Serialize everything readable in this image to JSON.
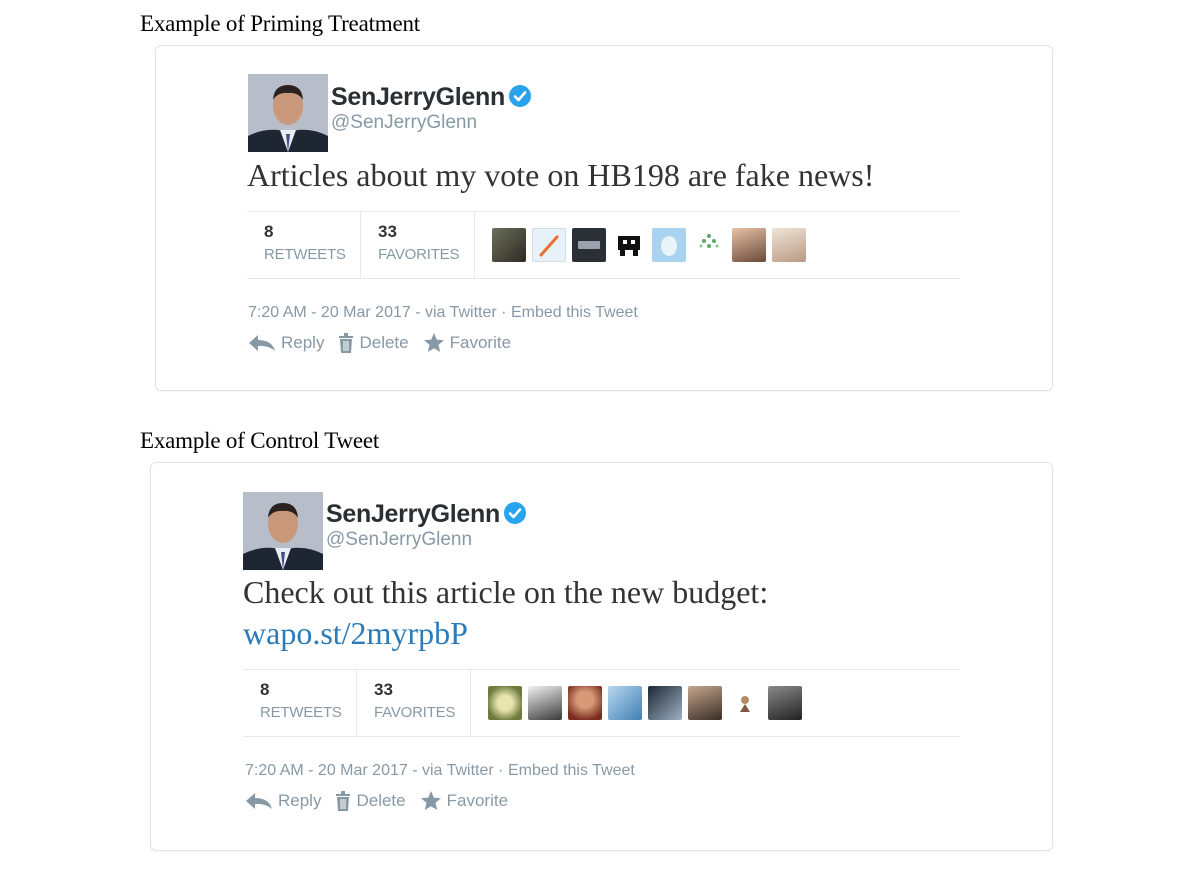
{
  "sections": [
    {
      "label": "Example of Priming Treatment",
      "tweet": {
        "display_name": "SenJerryGlenn",
        "handle": "@SenJerryGlenn",
        "text": "Articles about my vote on HB198 are fake news!",
        "retweets_count": "8",
        "retweets_label": "RETWEETS",
        "favorites_count": "33",
        "favorites_label": "FAVORITES",
        "timestamp": "7:20 AM - 20 Mar 2017",
        "via": " - via Twitter",
        "embed": " · Embed this Tweet",
        "actions": {
          "reply": "Reply",
          "delete": "Delete",
          "favorite": "Favorite"
        }
      }
    },
    {
      "label": "Example of Control Tweet",
      "tweet": {
        "display_name": "SenJerryGlenn",
        "handle": "@SenJerryGlenn",
        "text": "Check out this article on the new budget:",
        "link": "wapo.st/2myrpbP",
        "retweets_count": "8",
        "retweets_label": "RETWEETS",
        "favorites_count": "33",
        "favorites_label": "FAVORITES",
        "timestamp": "7:20 AM - 20 Mar 2017",
        "via": " - via Twitter",
        "embed": " · Embed this Tweet",
        "actions": {
          "reply": "Reply",
          "delete": "Delete",
          "favorite": "Favorite"
        }
      }
    }
  ],
  "icons": {
    "verified": "verified-badge-icon",
    "reply": "reply-arrow-icon",
    "delete": "trash-icon",
    "favorite": "star-icon"
  },
  "colors": {
    "verified_blue": "#2aa3ef",
    "link_blue": "#2b7bb9",
    "muted_gray": "#8899a6"
  }
}
